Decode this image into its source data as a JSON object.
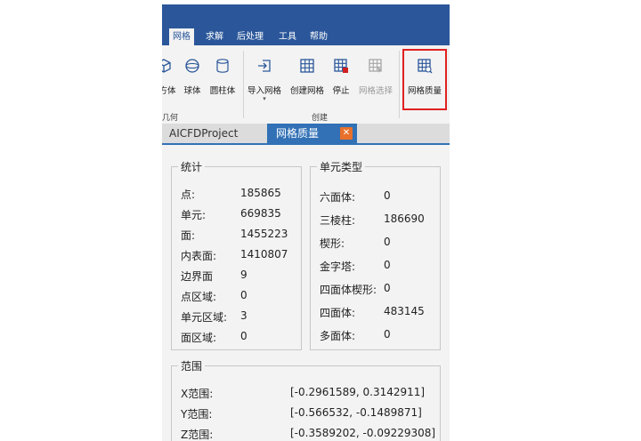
{
  "menu": {
    "items": [
      {
        "label": "网格",
        "active": true
      },
      {
        "label": "求解"
      },
      {
        "label": "后处理"
      },
      {
        "label": "工具"
      },
      {
        "label": "帮助"
      }
    ]
  },
  "ribbon": {
    "geometry_buttons": [
      {
        "label": "方体",
        "icon": "cube-icon"
      },
      {
        "label": "球体",
        "icon": "sphere-icon"
      },
      {
        "label": "圆柱体",
        "icon": "cylinder-icon"
      }
    ],
    "geometry_group_label": "几何",
    "create_buttons": [
      {
        "label": "导入网格",
        "icon": "import-mesh-icon"
      },
      {
        "label": "创建网格",
        "icon": "grid-icon"
      },
      {
        "label": "停止",
        "icon": "stop-grid-icon"
      },
      {
        "label": "网格选择",
        "icon": "grid-select-icon",
        "disabled": true
      }
    ],
    "create_group_label": "创建",
    "quality_button": {
      "label": "网格质量",
      "icon": "grid-quality-icon"
    }
  },
  "tabs": {
    "project": "AICFDProject",
    "quality": "网格质量",
    "close_icon": "close-icon"
  },
  "stats": {
    "title": "统计",
    "rows": [
      {
        "label": "点:",
        "value": "185865"
      },
      {
        "label": "单元:",
        "value": "669835"
      },
      {
        "label": "面:",
        "value": "1455223"
      },
      {
        "label": "内表面:",
        "value": "1410807"
      },
      {
        "label": "边界面",
        "value": "9"
      },
      {
        "label": "点区域:",
        "value": "0"
      },
      {
        "label": "单元区域:",
        "value": "3"
      },
      {
        "label": "面区域:",
        "value": "0"
      }
    ]
  },
  "cell_types": {
    "title": "单元类型",
    "rows": [
      {
        "label": "六面体:",
        "value": "0"
      },
      {
        "label": "三棱柱:",
        "value": "186690"
      },
      {
        "label": "楔形:",
        "value": "0"
      },
      {
        "label": "金字塔:",
        "value": "0"
      },
      {
        "label": "四面体楔形:",
        "value": "0"
      },
      {
        "label": "四面体:",
        "value": "483145"
      },
      {
        "label": "多面体:",
        "value": "0"
      }
    ]
  },
  "range": {
    "title": "范围",
    "rows": [
      {
        "label": "X范围:",
        "value": "[-0.2961589, 0.3142911]"
      },
      {
        "label": "Y范围:",
        "value": "[-0.566532, -0.1489871]"
      },
      {
        "label": "Z范围:",
        "value": "[-0.3589202, -0.09229308]"
      }
    ]
  },
  "colors": {
    "menubar": "#2b579a",
    "tab_active": "#3271b6",
    "close_button": "#e8702a",
    "highlight_border": "#e02020"
  }
}
